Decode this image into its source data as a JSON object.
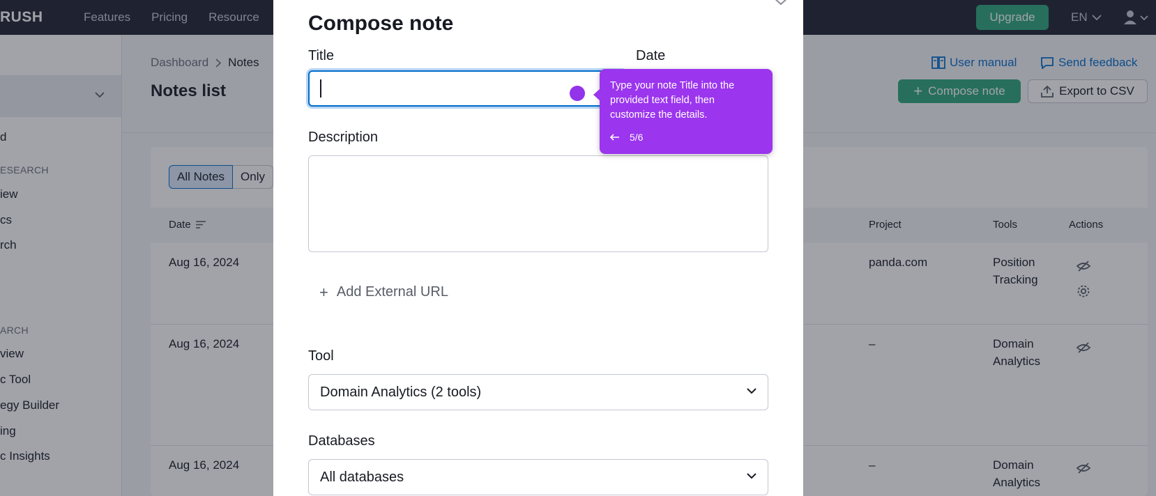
{
  "topnav": {
    "logo": "RUSH",
    "links": [
      "Features",
      "Pricing",
      "Resource"
    ],
    "upgrade": "Upgrade",
    "language": "EN"
  },
  "sidebar": {
    "items": [
      {
        "text": "d",
        "type": "item"
      },
      {
        "text": "ESEARCH",
        "type": "head"
      },
      {
        "text": "iew",
        "type": "item"
      },
      {
        "text": "cs",
        "type": "item"
      },
      {
        "text": "rch",
        "type": "item"
      },
      {
        "text": "ARCH",
        "type": "head"
      },
      {
        "text": "view",
        "type": "item"
      },
      {
        "text": "c Tool",
        "type": "item"
      },
      {
        "text": "egy Builder",
        "type": "item"
      },
      {
        "text": "ing",
        "type": "item"
      },
      {
        "text": "c Insights",
        "type": "item"
      }
    ]
  },
  "main": {
    "breadcrumb": {
      "root": "Dashboard",
      "current": "Notes"
    },
    "title": "Notes list",
    "user_manual": "User manual",
    "send_feedback": "Send feedback",
    "compose_button": "Compose note",
    "export_button": "Export to CSV",
    "filter": {
      "active": "All Notes",
      "other": "Only"
    },
    "columns": {
      "date": "Date",
      "project": "Project",
      "tools": "Tools",
      "actions": "Actions"
    },
    "rows": [
      {
        "date": "Aug 16, 2024",
        "project": "panda.com",
        "tools_line1": "Position",
        "tools_line2": "Tracking"
      },
      {
        "date": "Aug 16, 2024",
        "project": "–",
        "tools_line1": "Domain",
        "tools_line2": "Analytics"
      },
      {
        "date": "Aug 16, 2024",
        "project": "–",
        "tools_line1": "Domain",
        "tools_line2": "Analytics"
      }
    ]
  },
  "modal": {
    "title": "Compose note",
    "title_label": "Title",
    "title_value": "",
    "date_label": "Date",
    "description_label": "Description",
    "add_url": "Add External URL",
    "tool_label": "Tool",
    "tool_value": "Domain Analytics (2 tools)",
    "databases_label": "Databases",
    "databases_value": "All databases"
  },
  "tooltip": {
    "text": "Type your note Title into the provided text field, then customize the details.",
    "step": "5/6"
  },
  "colors": {
    "accent_green": "#2ea67a",
    "link_blue": "#006dca",
    "tooltip_purple": "#9b35ee",
    "nav_dark": "#1f2431"
  }
}
